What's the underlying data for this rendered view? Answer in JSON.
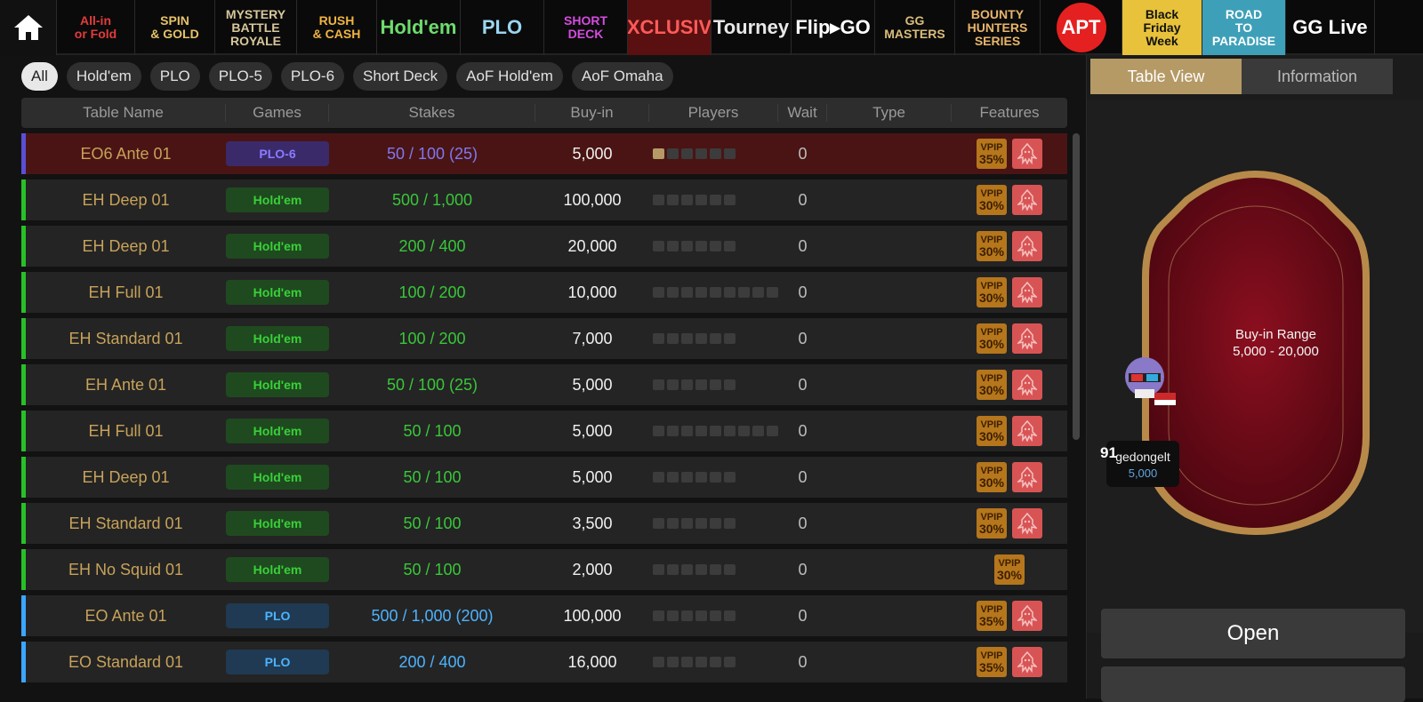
{
  "game_tabs": [
    {
      "label_top": "All-in",
      "label_bottom": "or Fold",
      "color": "#e23b3b"
    },
    {
      "label_top": "SPIN",
      "label_bottom": "& GOLD",
      "color": "#e6c36a"
    },
    {
      "label_top": "MYSTERY",
      "label_mid": "BATTLE",
      "label_bottom": "ROYALE",
      "color": "#d8c79a"
    },
    {
      "label_top": "RUSH",
      "label_bottom": "& CASH",
      "color": "#f0b443"
    },
    {
      "label_top": "Hold'em",
      "color": "#6ddc6d"
    },
    {
      "label_top": "PLO",
      "color": "#9ad6f0"
    },
    {
      "label_top": "SHORT",
      "label_bottom": "DECK",
      "color": "#d44be0"
    },
    {
      "label_top": "EXCLUSIVE",
      "color": "#ff5a5a"
    },
    {
      "label_top": "Tourney",
      "color": "#e8e8e8"
    },
    {
      "label_top": "Flip▸GO",
      "color": "#ffffff"
    },
    {
      "label_top": "GG",
      "label_bottom": "MASTERS",
      "color": "#d9bd7c"
    },
    {
      "label_top": "BOUNTY",
      "label_mid": "HUNTERS",
      "label_bottom": "SERIES",
      "color": "#e8b56a"
    },
    {
      "label_top": "APT",
      "color": "#ffffff"
    },
    {
      "label_top": "Black",
      "label_mid": "Friday",
      "label_bottom": "Week",
      "color": "#111111"
    },
    {
      "label_top": "ROAD",
      "label_mid": "TO",
      "label_bottom": "PARADISE",
      "color": "#ffffff"
    },
    {
      "label_top": "GG Live",
      "color": "#ffffff"
    }
  ],
  "filters": [
    "All",
    "Hold'em",
    "PLO",
    "PLO-5",
    "PLO-6",
    "Short Deck",
    "AoF Hold'em",
    "AoF Omaha"
  ],
  "columns": [
    "Table Name",
    "Games",
    "Stakes",
    "Buy-in",
    "Players",
    "Wait",
    "Type",
    "Features"
  ],
  "rows": [
    {
      "name": "EO6 Ante 01",
      "game": "PLO-6",
      "stakes": "50 / 100 (25)",
      "buyin": "5,000",
      "seats": 6,
      "seated": 1,
      "wait": "0",
      "vpip": "35%",
      "squid": true,
      "selected": true
    },
    {
      "name": "EH Deep 01",
      "game": "Hold'em",
      "stakes": "500 / 1,000",
      "buyin": "100,000",
      "seats": 6,
      "seated": 0,
      "wait": "0",
      "vpip": "30%",
      "squid": true
    },
    {
      "name": "EH Deep 01",
      "game": "Hold'em",
      "stakes": "200 / 400",
      "buyin": "20,000",
      "seats": 6,
      "seated": 0,
      "wait": "0",
      "vpip": "30%",
      "squid": true
    },
    {
      "name": "EH Full 01",
      "game": "Hold'em",
      "stakes": "100 / 200",
      "buyin": "10,000",
      "seats": 9,
      "seated": 0,
      "wait": "0",
      "vpip": "30%",
      "squid": true
    },
    {
      "name": "EH Standard 01",
      "game": "Hold'em",
      "stakes": "100 / 200",
      "buyin": "7,000",
      "seats": 6,
      "seated": 0,
      "wait": "0",
      "vpip": "30%",
      "squid": true
    },
    {
      "name": "EH Ante 01",
      "game": "Hold'em",
      "stakes": "50 / 100 (25)",
      "buyin": "5,000",
      "seats": 6,
      "seated": 0,
      "wait": "0",
      "vpip": "30%",
      "squid": true
    },
    {
      "name": "EH Full 01",
      "game": "Hold'em",
      "stakes": "50 / 100",
      "buyin": "5,000",
      "seats": 9,
      "seated": 0,
      "wait": "0",
      "vpip": "30%",
      "squid": true
    },
    {
      "name": "EH Deep 01",
      "game": "Hold'em",
      "stakes": "50 / 100",
      "buyin": "5,000",
      "seats": 6,
      "seated": 0,
      "wait": "0",
      "vpip": "30%",
      "squid": true
    },
    {
      "name": "EH Standard 01",
      "game": "Hold'em",
      "stakes": "50 / 100",
      "buyin": "3,500",
      "seats": 6,
      "seated": 0,
      "wait": "0",
      "vpip": "30%",
      "squid": true
    },
    {
      "name": "EH No Squid 01",
      "game": "Hold'em",
      "stakes": "50 / 100",
      "buyin": "2,000",
      "seats": 6,
      "seated": 0,
      "wait": "0",
      "vpip": "30%",
      "squid": false
    },
    {
      "name": "EO Ante 01",
      "game": "PLO",
      "stakes": "500 / 1,000 (200)",
      "buyin": "100,000",
      "seats": 6,
      "seated": 0,
      "wait": "0",
      "vpip": "35%",
      "squid": true
    },
    {
      "name": "EO Standard 01",
      "game": "PLO",
      "stakes": "200 / 400",
      "buyin": "16,000",
      "seats": 6,
      "seated": 0,
      "wait": "0",
      "vpip": "35%",
      "squid": true
    }
  ],
  "vpip_label": "VPIP",
  "game_colors": {
    "PLO-6": {
      "edge": "#5a4fd6",
      "pill_bg": "#3a2a6a",
      "pill_fg": "#8a7bff",
      "stake": "#7f78f0"
    },
    "Hold'em": {
      "edge": "#27c127",
      "pill_bg": "#1f4a1f",
      "pill_fg": "#39d039",
      "stake": "#39c739"
    },
    "PLO": {
      "edge": "#3aa6ff",
      "pill_bg": "#1f3a52",
      "pill_fg": "#4db3ff",
      "stake": "#4db3ff"
    }
  },
  "right_panel": {
    "tabs": [
      "Table View",
      "Information"
    ],
    "buyin_range_label": "Buy-in Range",
    "buyin_range_value": "5,000 - 20,000",
    "player": {
      "level": "91",
      "name": "gedongelt",
      "stack": "5,000"
    },
    "open_button": "Open"
  }
}
